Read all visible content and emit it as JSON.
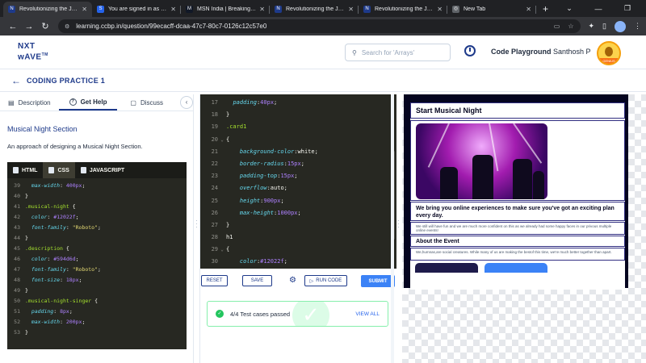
{
  "browser": {
    "tabs": [
      {
        "title": "Revolutionizing the Job M",
        "fav": "N",
        "color": "#1e3a8a",
        "active": true
      },
      {
        "title": "You are signed in as 7376",
        "fav": "S",
        "color": "#2563eb",
        "active": false
      },
      {
        "title": "MSN India | Breaking New",
        "fav": "M",
        "color": "#111827",
        "active": false
      },
      {
        "title": "Revolutionizing the Job M",
        "fav": "N",
        "color": "#1e3a8a",
        "active": false
      },
      {
        "title": "Revolutionizing the Job M",
        "fav": "N",
        "color": "#1e3a8a",
        "active": false
      },
      {
        "title": "New Tab",
        "fav": "◎",
        "color": "#5f6368",
        "active": false
      }
    ],
    "new_tab": "+",
    "url": "learning.ccbp.in/question/99ecacff-dcaa-47c7-80c7-0126c12c57e0"
  },
  "header": {
    "logo_line1": "NXT",
    "logo_line2": "wAVE",
    "logo_tm": "TM",
    "search_placeholder": "Search for 'Arrays'",
    "code_playground": "Code Playground",
    "user_name": "Santhosh P",
    "user_badge": "GENIUS"
  },
  "page": {
    "title": "CODING PRACTICE 1"
  },
  "left_tabs": [
    {
      "label": "Description",
      "icon": "document-icon"
    },
    {
      "label": "Get Help",
      "icon": "help-icon"
    },
    {
      "label": "Discuss",
      "icon": "chat-icon"
    }
  ],
  "help": {
    "section_title": "Musical Night Section",
    "section_desc": "An approach of designing a Musical Night Section."
  },
  "code_tabs": [
    "HTML",
    "CSS",
    "JAVASCRIPT"
  ],
  "css_lines": [
    {
      "n": "39",
      "parts": [
        [
          "  ",
          "pl"
        ],
        [
          "max-width",
          "prop"
        ],
        [
          ": ",
          "pl"
        ],
        [
          "400px",
          "num"
        ],
        [
          ";",
          "pl"
        ]
      ]
    },
    {
      "n": "40",
      "parts": [
        [
          "}",
          "pl"
        ]
      ]
    },
    {
      "n": "41",
      "parts": [
        [
          ".musical-night",
          "sel"
        ],
        [
          " {",
          "pl"
        ]
      ]
    },
    {
      "n": "42",
      "parts": [
        [
          "  ",
          "pl"
        ],
        [
          "color",
          "prop"
        ],
        [
          ": ",
          "pl"
        ],
        [
          "#12022f",
          "num"
        ],
        [
          ";",
          "pl"
        ]
      ]
    },
    {
      "n": "43",
      "parts": [
        [
          "  ",
          "pl"
        ],
        [
          "font-family",
          "prop"
        ],
        [
          ": ",
          "pl"
        ],
        [
          "\"Roboto\"",
          "str"
        ],
        [
          ";",
          "pl"
        ]
      ]
    },
    {
      "n": "44",
      "parts": [
        [
          "}",
          "pl"
        ]
      ]
    },
    {
      "n": "45",
      "parts": [
        [
          ".description",
          "sel"
        ],
        [
          " {",
          "pl"
        ]
      ]
    },
    {
      "n": "46",
      "parts": [
        [
          "  ",
          "pl"
        ],
        [
          "color",
          "prop"
        ],
        [
          ": ",
          "pl"
        ],
        [
          "#594d6d",
          "num"
        ],
        [
          ";",
          "pl"
        ]
      ]
    },
    {
      "n": "47",
      "parts": [
        [
          "  ",
          "pl"
        ],
        [
          "font-family",
          "prop"
        ],
        [
          ": ",
          "pl"
        ],
        [
          "\"Roboto\"",
          "str"
        ],
        [
          ";",
          "pl"
        ]
      ]
    },
    {
      "n": "48",
      "parts": [
        [
          "  ",
          "pl"
        ],
        [
          "font-size",
          "prop"
        ],
        [
          ": ",
          "pl"
        ],
        [
          "18px",
          "num"
        ],
        [
          ";",
          "pl"
        ]
      ]
    },
    {
      "n": "49",
      "parts": [
        [
          "}",
          "pl"
        ]
      ]
    },
    {
      "n": "50",
      "parts": [
        [
          ".musical-night-singer",
          "sel"
        ],
        [
          " {",
          "pl"
        ]
      ]
    },
    {
      "n": "51",
      "parts": [
        [
          "  ",
          "pl"
        ],
        [
          "padding",
          "prop"
        ],
        [
          ": ",
          "pl"
        ],
        [
          "8px",
          "num"
        ],
        [
          ";",
          "pl"
        ]
      ]
    },
    {
      "n": "52",
      "parts": [
        [
          "  ",
          "pl"
        ],
        [
          "max-width",
          "prop"
        ],
        [
          ": ",
          "pl"
        ],
        [
          "200px",
          "num"
        ],
        [
          ";",
          "pl"
        ]
      ]
    },
    {
      "n": "53",
      "parts": [
        [
          "}",
          "pl"
        ]
      ]
    }
  ],
  "editor_lines": [
    {
      "n": "17",
      "fold": "",
      "parts": [
        [
          "  ",
          "pl"
        ],
        [
          "padding",
          "prop"
        ],
        [
          ":",
          "pl"
        ],
        [
          "40px",
          "num"
        ],
        [
          ";",
          "pl"
        ]
      ]
    },
    {
      "n": "18",
      "fold": "",
      "parts": [
        [
          "}",
          "pl"
        ]
      ]
    },
    {
      "n": "19",
      "fold": "",
      "parts": [
        [
          ".card1",
          "sel"
        ]
      ]
    },
    {
      "n": "20",
      "fold": "⌄",
      "parts": [
        [
          "{",
          "pl"
        ]
      ]
    },
    {
      "n": "21",
      "fold": "",
      "parts": [
        [
          "    ",
          "pl"
        ],
        [
          "background-color",
          "prop"
        ],
        [
          ":",
          "pl"
        ],
        [
          "white",
          "pl"
        ],
        [
          ";",
          "pl"
        ]
      ]
    },
    {
      "n": "22",
      "fold": "",
      "parts": [
        [
          "    ",
          "pl"
        ],
        [
          "border-radius",
          "prop"
        ],
        [
          ":",
          "pl"
        ],
        [
          "15px",
          "num"
        ],
        [
          ";",
          "pl"
        ]
      ]
    },
    {
      "n": "23",
      "fold": "",
      "parts": [
        [
          "    ",
          "pl"
        ],
        [
          "padding-top",
          "prop"
        ],
        [
          ":",
          "pl"
        ],
        [
          "15px",
          "num"
        ],
        [
          ";",
          "pl"
        ]
      ]
    },
    {
      "n": "24",
      "fold": "",
      "parts": [
        [
          "    ",
          "pl"
        ],
        [
          "overflow",
          "prop"
        ],
        [
          ":",
          "pl"
        ],
        [
          "auto",
          "pl"
        ],
        [
          ";",
          "pl"
        ]
      ]
    },
    {
      "n": "25",
      "fold": "",
      "parts": [
        [
          "    ",
          "pl"
        ],
        [
          "height",
          "prop"
        ],
        [
          ":",
          "pl"
        ],
        [
          "900px",
          "num"
        ],
        [
          ";",
          "pl"
        ]
      ]
    },
    {
      "n": "26",
      "fold": "",
      "parts": [
        [
          "    ",
          "pl"
        ],
        [
          "max-height",
          "prop"
        ],
        [
          ":",
          "pl"
        ],
        [
          "1000px",
          "num"
        ],
        [
          ";",
          "pl"
        ]
      ]
    },
    {
      "n": "27",
      "fold": "",
      "parts": [
        [
          "}",
          "pl"
        ]
      ]
    },
    {
      "n": "28",
      "fold": "",
      "parts": [
        [
          "h1",
          "pl"
        ]
      ]
    },
    {
      "n": "29",
      "fold": "⌄",
      "parts": [
        [
          "{",
          "pl"
        ]
      ]
    },
    {
      "n": "30",
      "fold": "",
      "parts": [
        [
          "    ",
          "pl"
        ],
        [
          "color",
          "prop"
        ],
        [
          ":",
          "pl"
        ],
        [
          "#12022f",
          "num"
        ],
        [
          ";",
          "pl"
        ]
      ]
    }
  ],
  "actions": {
    "reset": "RESET",
    "save": "SAVE",
    "run_code": "RUN CODE",
    "submit": "SUBMIT"
  },
  "result": {
    "text": "4/4 Test cases passed",
    "view_all": "VIEW ALL"
  },
  "preview": {
    "title": "Start Musical Night",
    "tagline": "We bring you online experiences to make sure you've got an exciting plan every day.",
    "para1": "We still will have fun and we are much more confident on this as we already had some happy faces in our privous multiple online events!",
    "about_heading": "About the Event",
    "para2": "We,humnas,are social creatures. While many of us are making the bestof this time, we're much better together than apart."
  }
}
